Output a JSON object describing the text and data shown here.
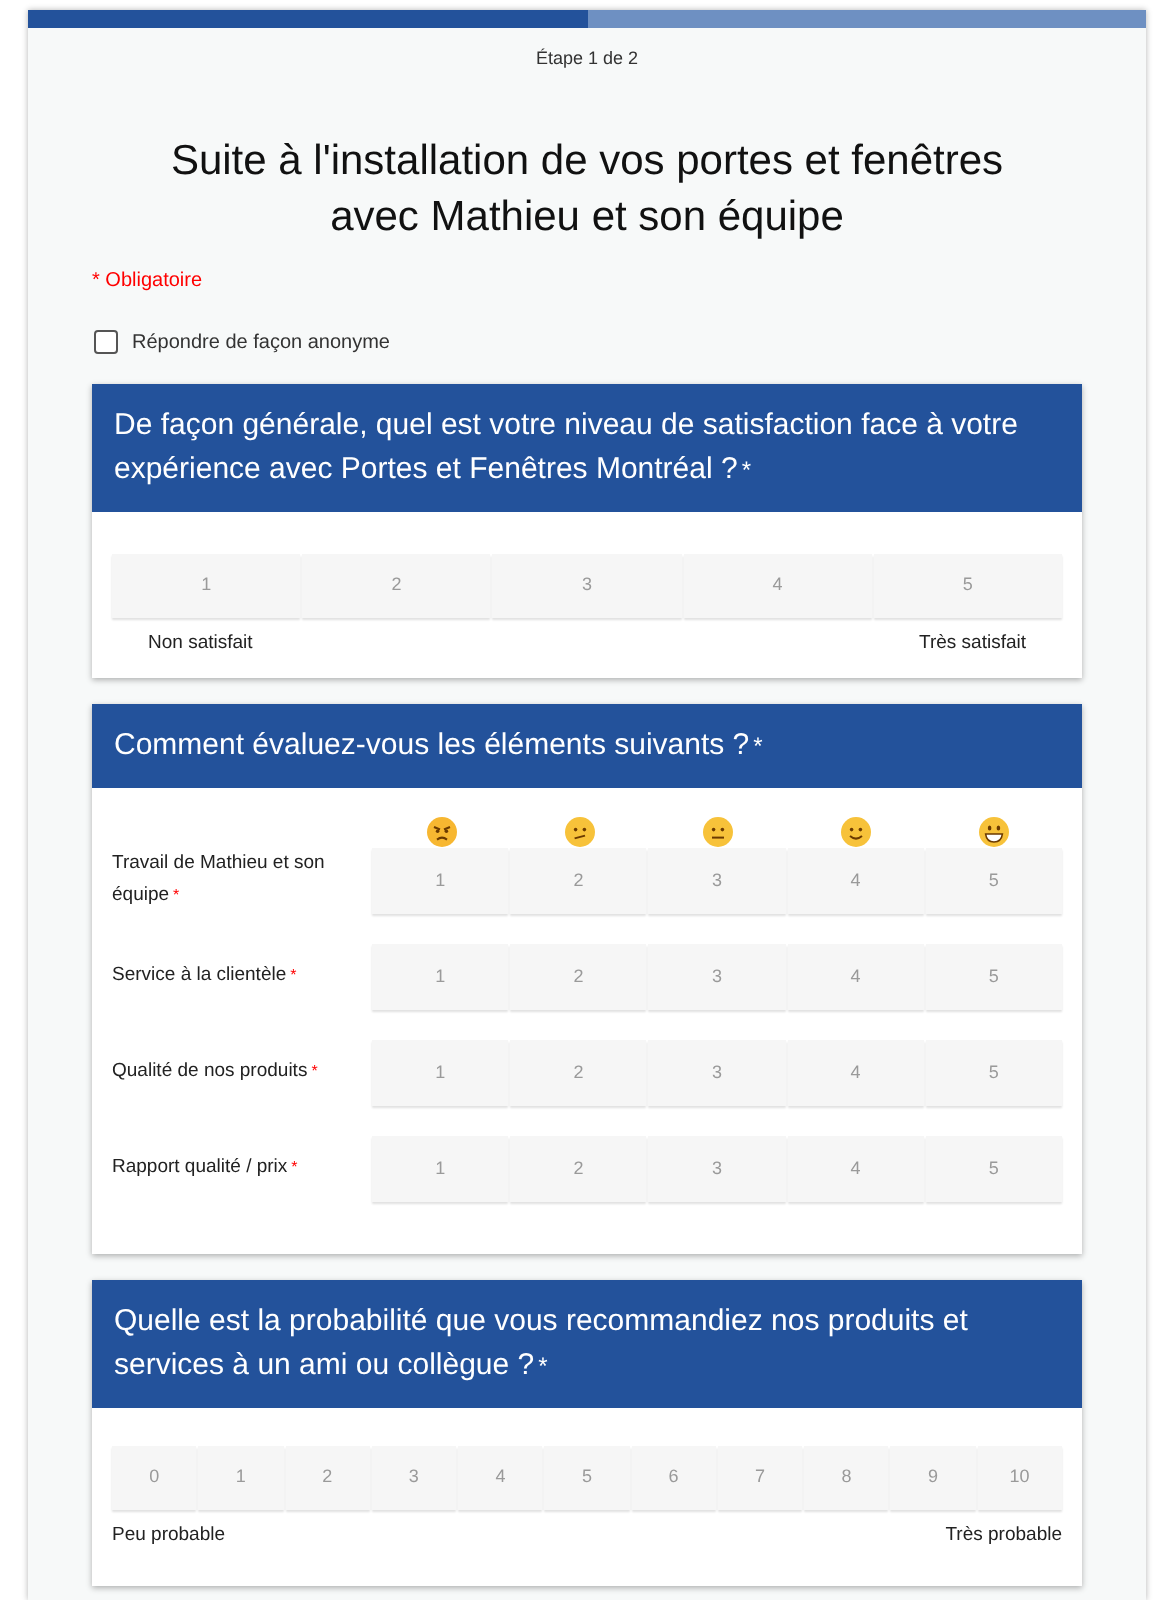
{
  "progress": {
    "level": 0.5
  },
  "step": "Étape 1 de 2",
  "title": "Suite à l'installation de vos portes et fenêtres avec Mathieu et son équipe",
  "required_note": "* Obligatoire",
  "anonymous": {
    "label": "Répondre de façon anonyme",
    "checked": false
  },
  "questions": [
    {
      "kind": "scale",
      "title": "De façon générale, quel est votre niveau de satisfaction face à votre expérience avec Portes et Fenêtres Montréal ?",
      "required_mark": "*",
      "options": [
        "1",
        "2",
        "3",
        "4",
        "5"
      ],
      "low_label": "Non satisfait",
      "high_label": "Très satisfait"
    },
    {
      "kind": "matrix",
      "title": "Comment évaluez-vous les éléments suivants ?",
      "required_mark": "*",
      "face_columns": [
        {
          "kind": "angry"
        },
        {
          "kind": "confused"
        },
        {
          "kind": "neutral"
        },
        {
          "kind": "smile"
        },
        {
          "kind": "grin"
        }
      ],
      "rows": [
        {
          "label": "Travail de Mathieu et son équipe",
          "required_mark": "*",
          "options": [
            "1",
            "2",
            "3",
            "4",
            "5"
          ]
        },
        {
          "label": "Service à la clientèle",
          "required_mark": "*",
          "options": [
            "1",
            "2",
            "3",
            "4",
            "5"
          ]
        },
        {
          "label": "Qualité de nos produits",
          "required_mark": "*",
          "options": [
            "1",
            "2",
            "3",
            "4",
            "5"
          ]
        },
        {
          "label": "Rapport qualité / prix",
          "required_mark": "*",
          "options": [
            "1",
            "2",
            "3",
            "4",
            "5"
          ]
        }
      ]
    },
    {
      "kind": "nps",
      "title": "Quelle est la probabilité que vous recommandiez nos produits et services à un ami ou collègue ?",
      "required_mark": "*",
      "options": [
        "0",
        "1",
        "2",
        "3",
        "4",
        "5",
        "6",
        "7",
        "8",
        "9",
        "10"
      ],
      "low_label": "Peu probable",
      "high_label": "Très probable"
    }
  ]
}
